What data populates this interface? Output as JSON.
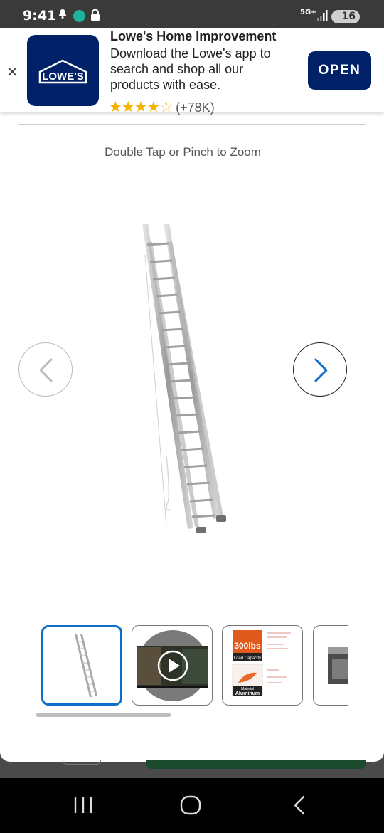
{
  "status_bar": {
    "time": "9:41",
    "network": "5G+",
    "battery": "16"
  },
  "app_banner": {
    "app_name": "Lowe's Home Improvement",
    "description": "Download the Lowe's app to search and shop all our products with ease.",
    "stars": "★★★★☆",
    "rating_count": "(+78K)",
    "logo_text": "LOWE'S",
    "open_label": "OPEN",
    "close_label": "✕",
    "brand_color": "#012169"
  },
  "gallery": {
    "zoom_hint": "Double Tap or Pinch to Zoom",
    "thumbnails": [
      {
        "kind": "image",
        "active": true
      },
      {
        "kind": "video",
        "active": false
      },
      {
        "kind": "image",
        "active": false
      },
      {
        "kind": "image",
        "active": false
      }
    ],
    "infographic": {
      "load": "300lbs",
      "load_label": "Load Capacity",
      "material_label": "Material",
      "material": "Aluminum"
    },
    "active_color": "#0c6ec9"
  },
  "icons": {
    "prev": "chevron-left-icon",
    "next": "chevron-right-icon",
    "play": "play-icon",
    "recents": "recent-apps-icon",
    "home": "home-icon",
    "back": "back-icon"
  }
}
